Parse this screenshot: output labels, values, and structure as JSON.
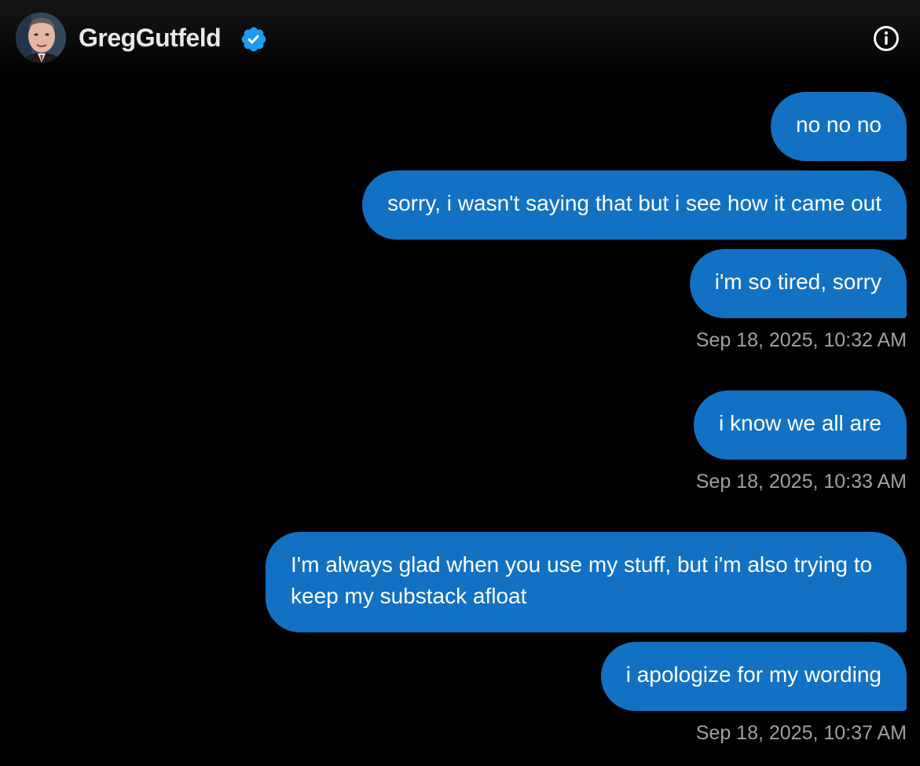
{
  "header": {
    "contact_name": "GregGutfeld",
    "verified_icon": "verified-badge-icon",
    "info_icon": "info-icon"
  },
  "colors": {
    "background": "#000000",
    "bubble": "#1271c2",
    "timestamp": "#a0a0a0",
    "verified": "#1d9bf0"
  },
  "messages": [
    {
      "text": "no no no"
    },
    {
      "text": "sorry, i wasn't saying that but i see how it came out"
    },
    {
      "text": "i'm so tired, sorry"
    },
    {
      "timestamp": "Sep 18, 2025, 10:32 AM"
    },
    {
      "text": "i know we all are"
    },
    {
      "timestamp": "Sep 18, 2025, 10:33 AM"
    },
    {
      "text": "I'm always glad when you use my stuff, but i'm also trying to keep my substack afloat"
    },
    {
      "text": "i apologize for my wording"
    },
    {
      "timestamp": "Sep 18, 2025, 10:37 AM"
    }
  ]
}
